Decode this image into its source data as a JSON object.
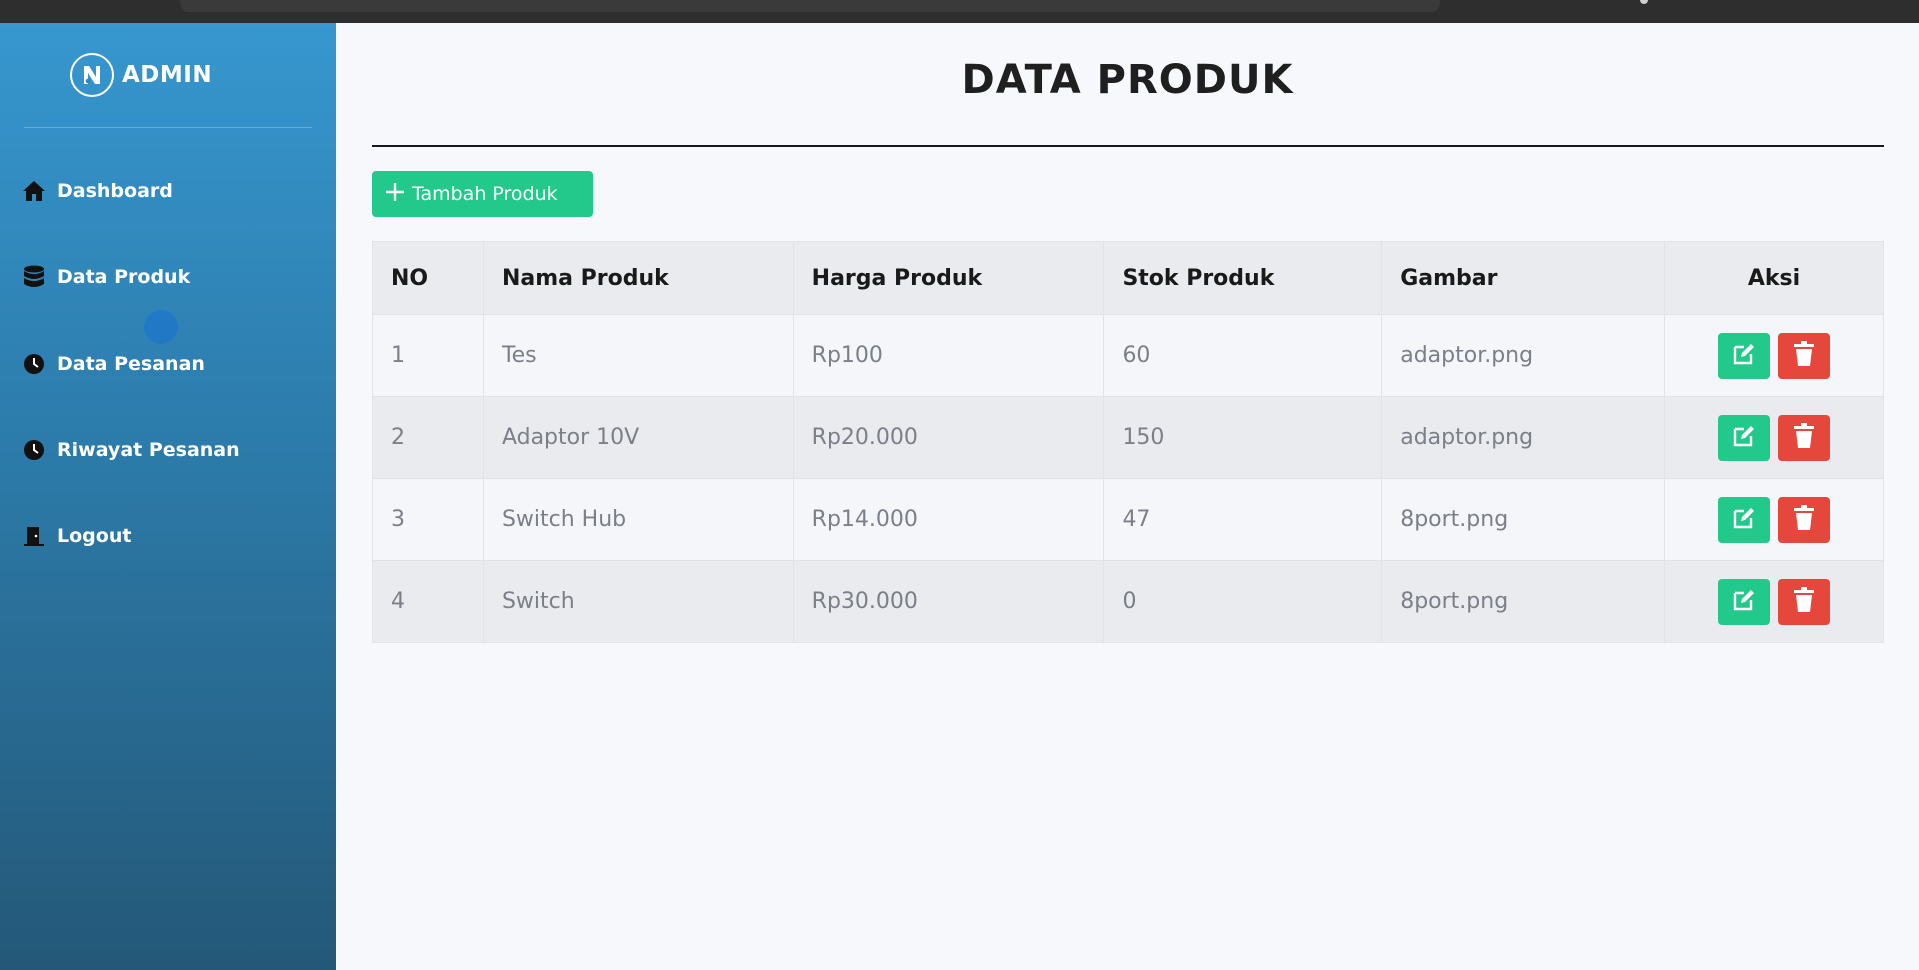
{
  "brand": {
    "text": "ADMIN"
  },
  "sidebar": {
    "items": [
      {
        "label": "Dashboard",
        "icon": "home-icon"
      },
      {
        "label": "Data Produk",
        "icon": "database-icon"
      },
      {
        "label": "Data Pesanan",
        "icon": "clock-icon"
      },
      {
        "label": "Riwayat Pesanan",
        "icon": "clock-icon"
      },
      {
        "label": "Logout",
        "icon": "door-exit-icon"
      }
    ]
  },
  "page": {
    "title": "DATA PRODUK"
  },
  "toolbar": {
    "add_label": "Tambah Produk"
  },
  "table": {
    "headers": [
      "NO",
      "Nama Produk",
      "Harga Produk",
      "Stok Produk",
      "Gambar",
      "Aksi"
    ],
    "rows": [
      [
        "1",
        "Tes",
        "Rp100",
        "60",
        "adaptor.png"
      ],
      [
        "2",
        "Adaptor 10V",
        "Rp20.000",
        "150",
        "adaptor.png"
      ],
      [
        "3",
        "Switch Hub",
        "Rp14.000",
        "47",
        "8port.png"
      ],
      [
        "4",
        "Switch",
        "Rp30.000",
        "0",
        "8port.png"
      ]
    ]
  },
  "colors": {
    "sidebar_top": "#3797cf",
    "sidebar_bottom": "#245878",
    "success": "#22c98a",
    "danger": "#e5473c"
  }
}
